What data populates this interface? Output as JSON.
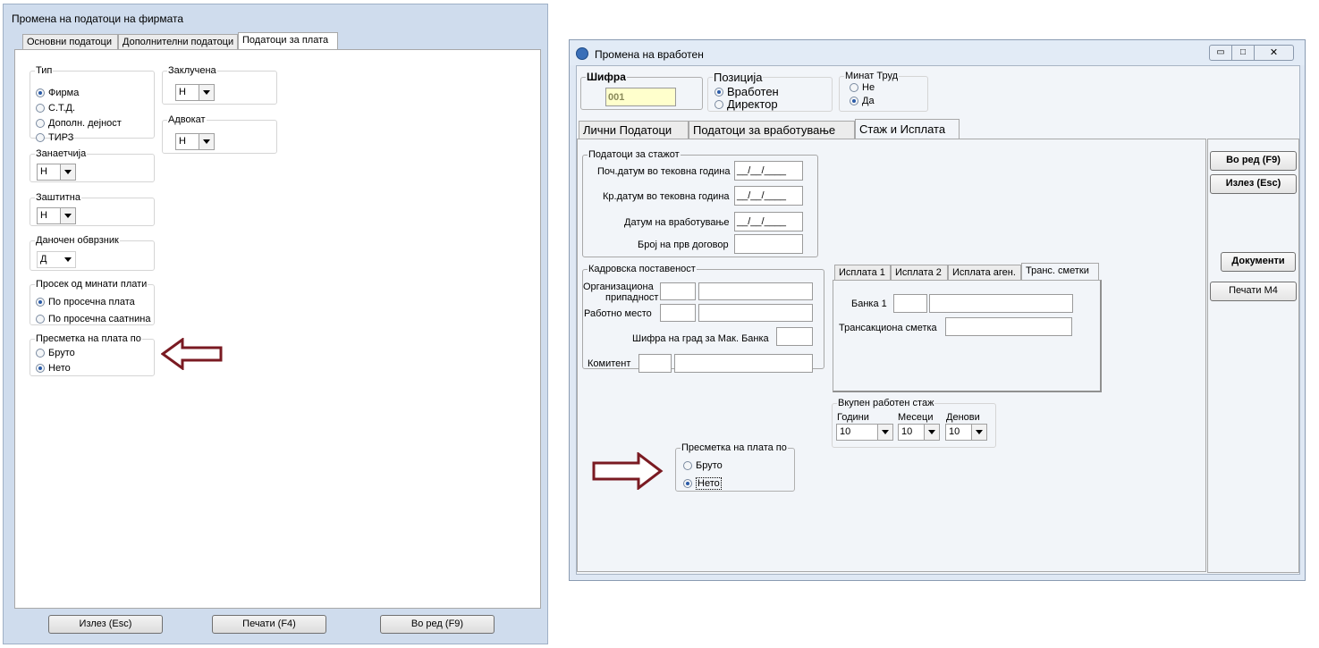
{
  "left_window": {
    "title": "Промена на податоци на фирмата",
    "tabs": [
      "Основни податоци",
      "Дополнителни податоци",
      "Податоци за плата"
    ],
    "tip": {
      "legend": "Тип",
      "options": [
        "Фирма",
        "С.Т.Д.",
        "Дополн. дејност",
        "ТИРЗ"
      ],
      "selected": 0
    },
    "zakluchena": {
      "legend": "Заклучена",
      "value": "Н"
    },
    "advokat": {
      "legend": "Адвокат",
      "value": "Н"
    },
    "zanaetchija": {
      "legend": "Занаетчија",
      "value": "Н"
    },
    "zashtitna": {
      "legend": "Заштитна",
      "value": "Н"
    },
    "danochen": {
      "legend": "Даночен обврзник",
      "value": "Д"
    },
    "prosek": {
      "legend": "Просек од минати плати",
      "options": [
        "По просечна плата",
        "По просечна саатнина"
      ],
      "selected": 0
    },
    "presmetka": {
      "legend": "Пресметка на плата по",
      "options": [
        "Бруто",
        "Нето"
      ],
      "selected": 1
    },
    "buttons": {
      "izlez": "Излез (Esc)",
      "pechati": "Печати (F4)",
      "vo_red": "Во ред (F9)"
    }
  },
  "right_window": {
    "title": "Промена на вработен",
    "shifra": {
      "label": "Шифра",
      "value": "001"
    },
    "pozicija": {
      "legend": "Позиција",
      "options": [
        "Вработен",
        "Директор"
      ],
      "selected": 0
    },
    "minat_trud": {
      "legend": "Минат Труд",
      "options": [
        "Не",
        "Да"
      ],
      "selected": 1
    },
    "tabs": [
      "Лични Податоци",
      "Податоци за вработување",
      "Стаж и Исплата"
    ],
    "staz": {
      "legend": "Податоци за стажот",
      "rows": [
        {
          "label": "Поч.датум во тековна година",
          "value": "__/__/____"
        },
        {
          "label": "Кр.датум во тековна година",
          "value": "__/__/____"
        },
        {
          "label": "Датум на вработување",
          "value": "__/__/____"
        },
        {
          "label": "Број на прв договор",
          "value": ""
        }
      ]
    },
    "kadrovska": {
      "legend": "Кадровска поставеност",
      "org_label_1": "Организациона",
      "org_label_2": "припадност",
      "rabotno_mesto": "Работно место",
      "shifra_grad": "Шифра на град за Мак. Банка",
      "komitent": "Комитент"
    },
    "isplata_tabs": [
      "Исплата 1",
      "Исплата 2",
      "Исплата аген.",
      "Транс. сметки"
    ],
    "banka_label": "Банка 1",
    "trans_label": "Трансакциона сметка",
    "vkupen": {
      "legend": "Вкупен работен стаж",
      "godini": {
        "label": "Години",
        "value": "10"
      },
      "meseci": {
        "label": "Месеци",
        "value": "10"
      },
      "denovi": {
        "label": "Денови",
        "value": "10"
      }
    },
    "presmetka": {
      "legend": "Пресметка на плата по",
      "options": [
        "Бруто",
        "Нето"
      ],
      "selected": 1
    },
    "buttons": {
      "vo_red": "Во ред (F9)",
      "izlez": "Излез (Esc)",
      "dokumenti": "Документи",
      "pechati_m4": "Печати М4"
    }
  },
  "colors": {
    "arrow": "#7a1a22",
    "accent_field": "#ffffcc",
    "window_frame": "#cfdced"
  }
}
